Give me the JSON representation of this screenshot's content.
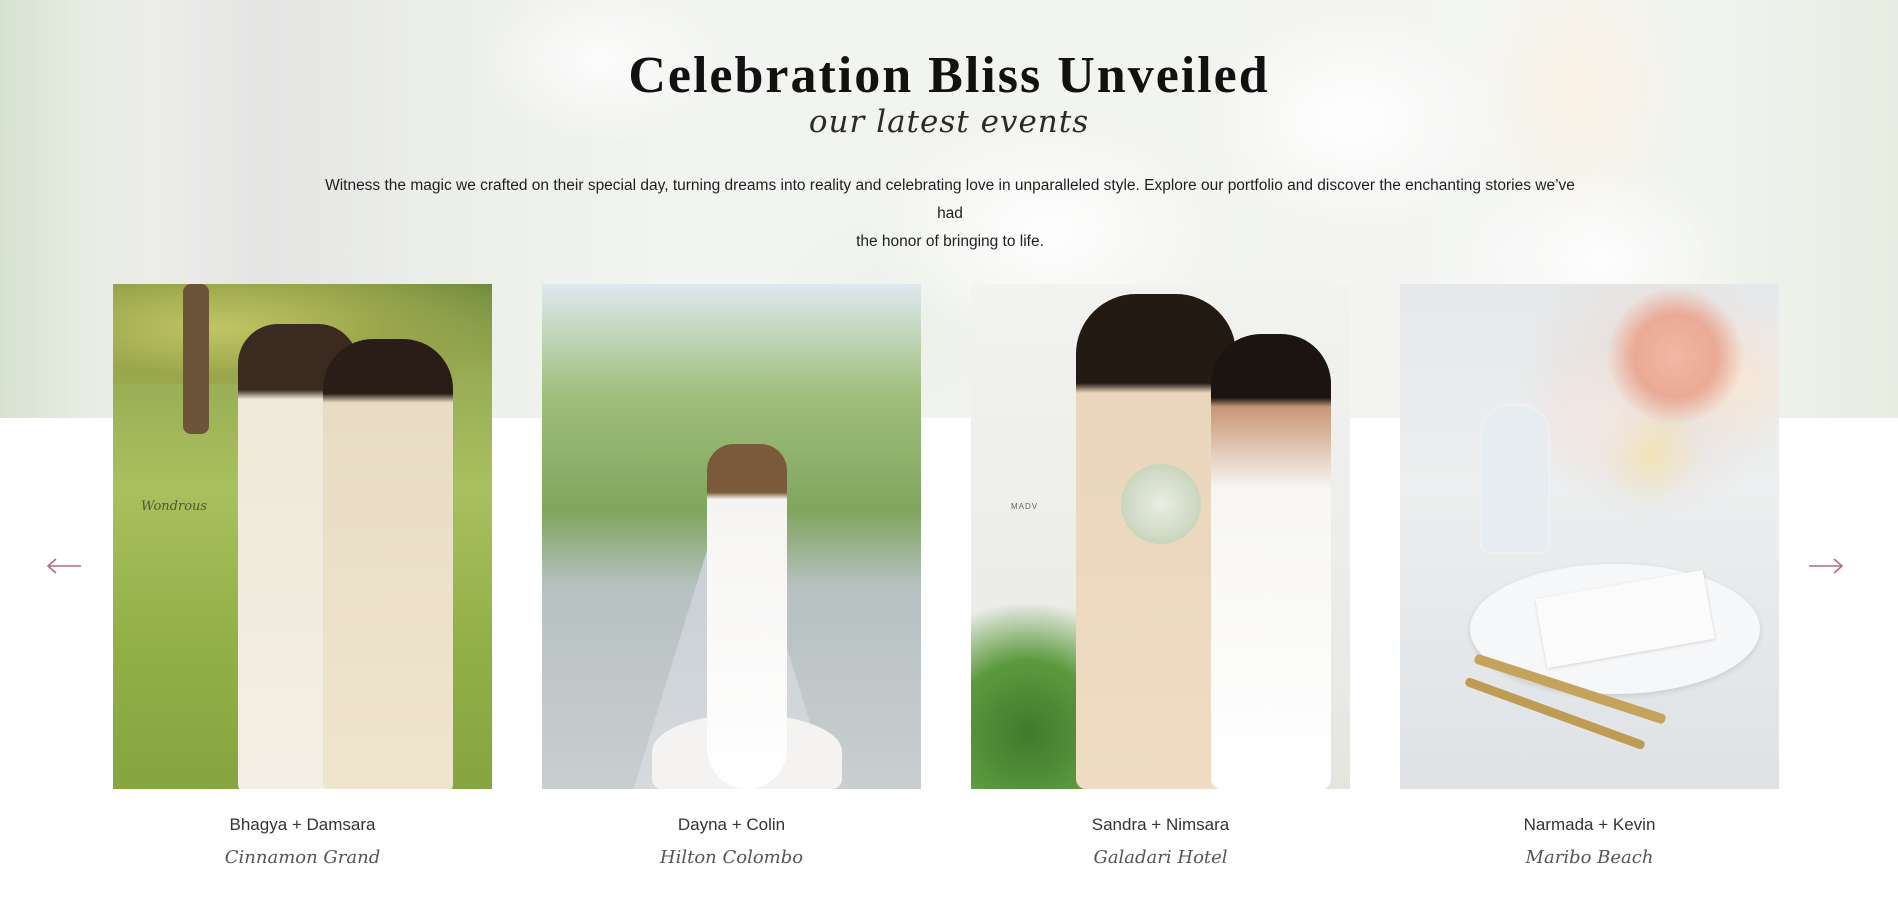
{
  "section": {
    "title": "Celebration Bliss Unveiled",
    "subtitle": "our latest events",
    "intro_line1": "Witness the magic we crafted on their special day, turning dreams into reality and celebrating love in unparalleled style. Explore our portfolio and discover the enchanting stories we’ve had",
    "intro_line2": "the honor of bringing to life."
  },
  "carousel": {
    "arrow_color": "#b06b7c",
    "events": [
      {
        "names": "Bhagya + Damsara",
        "venue": "Cinnamon Grand",
        "photo_mark": "Wondrous"
      },
      {
        "names": "Dayna + Colin",
        "venue": "Hilton Colombo"
      },
      {
        "names": "Sandra + Nimsara",
        "venue": "Galadari Hotel",
        "photo_mark": "MADV"
      },
      {
        "names": "Narmada + Kevin",
        "venue": "Maribo Beach"
      }
    ]
  }
}
